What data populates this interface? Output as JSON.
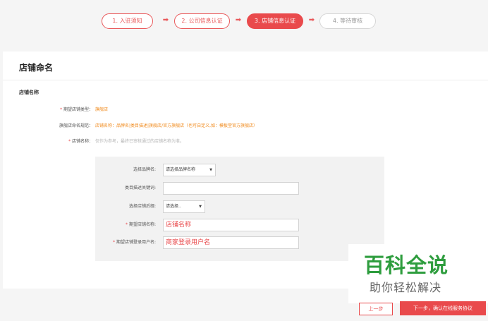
{
  "steps": [
    {
      "label": "1. 入驻须知"
    },
    {
      "label": "2. 公司信息认证"
    },
    {
      "label": "3. 店铺信息认证"
    },
    {
      "label": "4. 等待审核"
    }
  ],
  "card": {
    "title": "店铺命名",
    "section": "店铺名称",
    "rows": {
      "type_label": "期望店铺类型：",
      "type_value": "旗舰店",
      "rule_label": "旗舰店命名规范：",
      "rule_value": "店铺名称：品牌名|类目描述|旗舰店/官方旗舰店（也可自定义,如：模板堂官方旗舰店）",
      "name_label": "店铺名称：",
      "name_hint": "仅作为参考，最终已审核通过的店铺名称为准。"
    }
  },
  "form": {
    "brand_label": "选择品牌名:",
    "brand_value": "请选择品牌名称",
    "keyword_label": "类目描述关键词:",
    "keyword_value": "",
    "suffix_label": "选择店铺后缀:",
    "suffix_value": "请选择..",
    "shop_name_label": "期望店铺名称:",
    "shop_name_value": "店铺名称",
    "login_label": "期望店铺登录用户名:",
    "login_value": "商家登录用户名"
  },
  "watermark": {
    "big": "百科全说",
    "small": "助你轻松解决"
  },
  "buttons": {
    "prev": "上一步",
    "next": "下一步，确认在线服务协议"
  },
  "colors": {
    "accent": "#e94a4c",
    "orange": "#f08a1c",
    "watermark_green": "#2e9d3e"
  }
}
